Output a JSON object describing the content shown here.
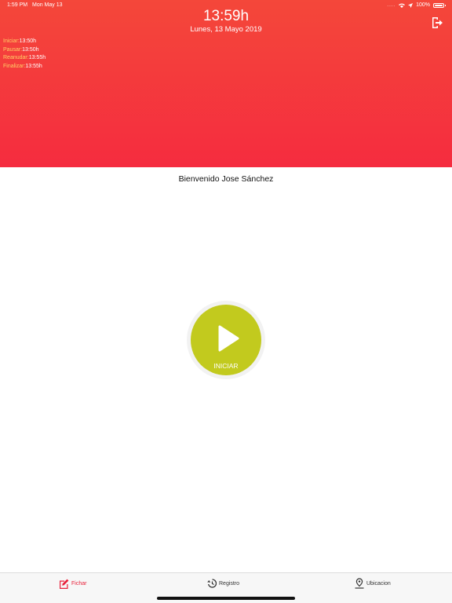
{
  "status_bar": {
    "time": "1:59 PM",
    "date": "Mon May 13",
    "dots": "....",
    "battery": "100%"
  },
  "header": {
    "clock": "13:59h",
    "date": "Lunes, 13 Mayo 2019",
    "background_colors": [
      "#f4473a",
      "#f52c3f"
    ],
    "logout_icon": "logout-icon"
  },
  "times": [
    {
      "label": "Iniciar:",
      "value": "13:50h"
    },
    {
      "label": "Pausar:",
      "value": "13:50h"
    },
    {
      "label": "Reanudar:",
      "value": "13:55h"
    },
    {
      "label": "Finalizar:",
      "value": "13:55h"
    }
  ],
  "welcome": "Bienvenido Jose Sánchez",
  "start_button": {
    "label": "INICIAR",
    "color": "#c2ca1e",
    "icon": "play-icon"
  },
  "tabs": [
    {
      "label": "Fichar",
      "icon": "edit-icon",
      "active": true
    },
    {
      "label": "Registro",
      "icon": "history-icon",
      "active": false
    },
    {
      "label": "Ubicacion",
      "icon": "location-icon",
      "active": false
    }
  ],
  "colors": {
    "active_tab": "#e8213a",
    "time_label": "#ffd166"
  }
}
